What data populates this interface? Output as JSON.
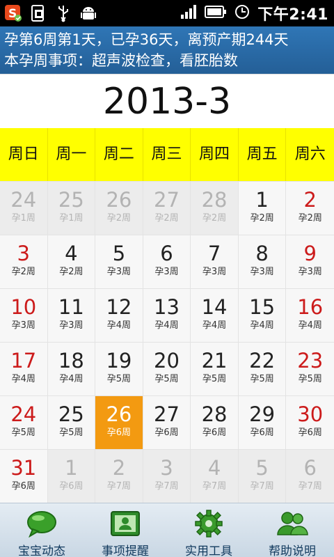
{
  "status_bar": {
    "time": "下午2:41",
    "icons": [
      "app-badge-icon",
      "screenshot-icon",
      "usb-icon",
      "android-debug-icon",
      "signal-icon",
      "battery-icon",
      "alarm-icon"
    ]
  },
  "banner": {
    "line1": "孕第6周第1天，已孕36天，离预产期244天",
    "line2": "本孕周事项：超声波检查，看胚胎数"
  },
  "calendar": {
    "month_title": "2013-3",
    "weekdays": [
      "周日",
      "周一",
      "周二",
      "周三",
      "周四",
      "周五",
      "周六"
    ],
    "weeks": [
      [
        {
          "d": "24",
          "w": "孕1周",
          "other": true
        },
        {
          "d": "25",
          "w": "孕1周",
          "other": true
        },
        {
          "d": "26",
          "w": "孕2周",
          "other": true
        },
        {
          "d": "27",
          "w": "孕2周",
          "other": true
        },
        {
          "d": "28",
          "w": "孕2周",
          "other": true
        },
        {
          "d": "1",
          "w": "孕2周"
        },
        {
          "d": "2",
          "w": "孕2周"
        }
      ],
      [
        {
          "d": "3",
          "w": "孕2周"
        },
        {
          "d": "4",
          "w": "孕2周"
        },
        {
          "d": "5",
          "w": "孕3周"
        },
        {
          "d": "6",
          "w": "孕3周"
        },
        {
          "d": "7",
          "w": "孕3周"
        },
        {
          "d": "8",
          "w": "孕3周"
        },
        {
          "d": "9",
          "w": "孕3周"
        }
      ],
      [
        {
          "d": "10",
          "w": "孕3周"
        },
        {
          "d": "11",
          "w": "孕3周"
        },
        {
          "d": "12",
          "w": "孕4周"
        },
        {
          "d": "13",
          "w": "孕4周"
        },
        {
          "d": "14",
          "w": "孕4周"
        },
        {
          "d": "15",
          "w": "孕4周"
        },
        {
          "d": "16",
          "w": "孕4周"
        }
      ],
      [
        {
          "d": "17",
          "w": "孕4周"
        },
        {
          "d": "18",
          "w": "孕4周"
        },
        {
          "d": "19",
          "w": "孕5周"
        },
        {
          "d": "20",
          "w": "孕5周"
        },
        {
          "d": "21",
          "w": "孕5周"
        },
        {
          "d": "22",
          "w": "孕5周"
        },
        {
          "d": "23",
          "w": "孕5周"
        }
      ],
      [
        {
          "d": "24",
          "w": "孕5周"
        },
        {
          "d": "25",
          "w": "孕5周"
        },
        {
          "d": "26",
          "w": "孕6周",
          "today": true
        },
        {
          "d": "27",
          "w": "孕6周"
        },
        {
          "d": "28",
          "w": "孕6周"
        },
        {
          "d": "29",
          "w": "孕6周"
        },
        {
          "d": "30",
          "w": "孕6周"
        }
      ],
      [
        {
          "d": "31",
          "w": "孕6周"
        },
        {
          "d": "1",
          "w": "孕6周",
          "other": true
        },
        {
          "d": "2",
          "w": "孕7周",
          "other": true
        },
        {
          "d": "3",
          "w": "孕7周",
          "other": true
        },
        {
          "d": "4",
          "w": "孕7周",
          "other": true
        },
        {
          "d": "5",
          "w": "孕7周",
          "other": true
        },
        {
          "d": "6",
          "w": "孕7周",
          "other": true
        }
      ]
    ]
  },
  "bottom_nav": [
    {
      "label": "宝宝动态",
      "icon": "speech-bubble-icon"
    },
    {
      "label": "事项提醒",
      "icon": "contact-card-icon"
    },
    {
      "label": "实用工具",
      "icon": "gear-icon"
    },
    {
      "label": "帮助说明",
      "icon": "people-icon"
    }
  ],
  "colors": {
    "banner": "#2f76b6",
    "weekday_row": "#ffff00",
    "today": "#f39a11",
    "weekend_text": "#cc1b1b"
  }
}
